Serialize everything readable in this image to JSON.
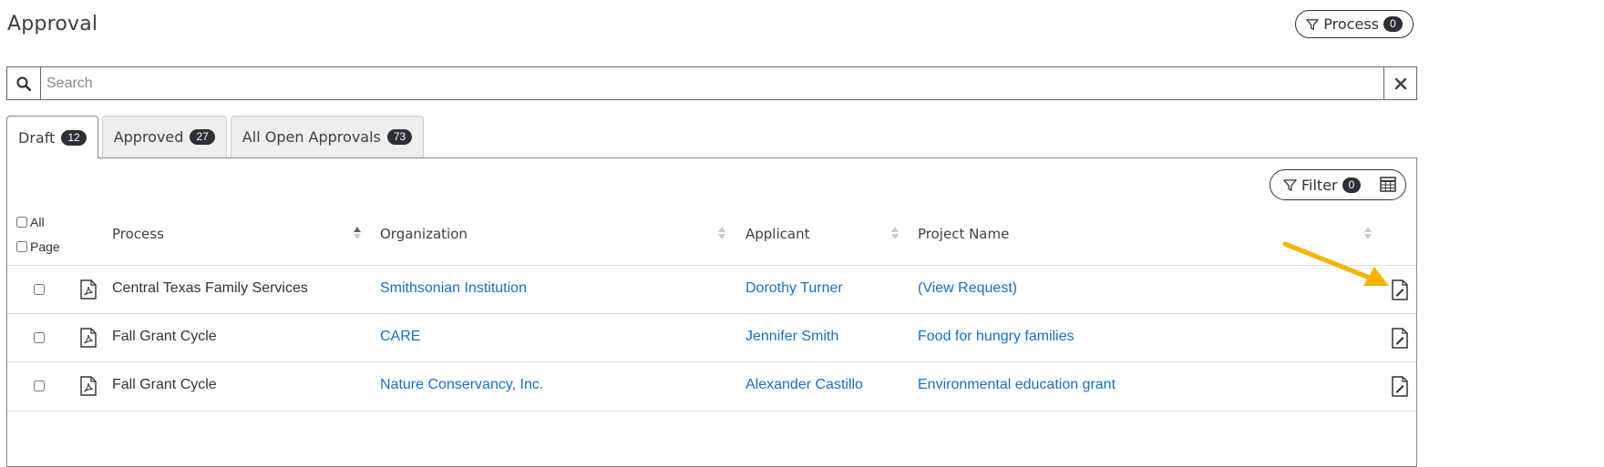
{
  "page": {
    "title": "Approval"
  },
  "process_button": {
    "label": "Process",
    "count": "0"
  },
  "search": {
    "placeholder": "Search",
    "value": ""
  },
  "tabs": [
    {
      "label": "Draft",
      "count": "12",
      "active": true
    },
    {
      "label": "Approved",
      "count": "27",
      "active": false
    },
    {
      "label": "All Open Approvals",
      "count": "73",
      "active": false
    }
  ],
  "toolbar": {
    "filter_label": "Filter",
    "filter_count": "0"
  },
  "select": {
    "all_label": "All",
    "page_label": "Page"
  },
  "columns": {
    "process": "Process",
    "organization": "Organization",
    "applicant": "Applicant",
    "project_name": "Project Name"
  },
  "rows": [
    {
      "process": "Central Texas Family Services",
      "organization": "Smithsonian Institution",
      "applicant": "Dorothy Turner",
      "project_name": "(View Request)"
    },
    {
      "process": "Fall Grant Cycle",
      "organization": "CARE",
      "applicant": "Jennifer Smith",
      "project_name": "Food for hungry families"
    },
    {
      "process": "Fall Grant Cycle",
      "organization": "Nature Conservancy, Inc.",
      "applicant": "Alexander Castillo",
      "project_name": "Environmental education grant"
    }
  ],
  "colors": {
    "link": "#1a6fc4",
    "badge": "#2b2f36",
    "annotation_arrow": "#f5b400"
  },
  "icons": {
    "search": "search-icon",
    "clear": "close-icon",
    "filter": "filter-icon",
    "grid": "table-grid-icon",
    "pdf": "pdf-file-icon",
    "edit": "edit-document-icon"
  }
}
